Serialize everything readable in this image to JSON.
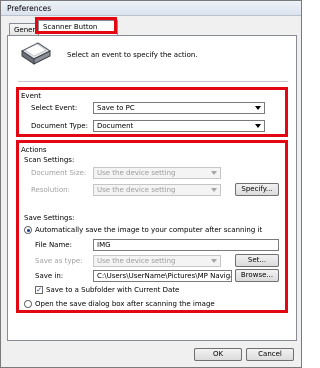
{
  "window": {
    "title": "Preferences"
  },
  "tabs": [
    {
      "label": "General"
    },
    {
      "label": "Scanner Button Settings"
    }
  ],
  "intro_text": "Select an event to specify the action.",
  "event": {
    "group_label": "Event",
    "select_event_label": "Select Event:",
    "select_event_value": "Save to PC",
    "document_type_label": "Document Type:",
    "document_type_value": "Document"
  },
  "actions": {
    "group_label": "Actions",
    "scan_settings_label": "Scan Settings:",
    "document_size_label": "Document Size:",
    "document_size_value": "Use the device setting",
    "resolution_label": "Resolution:",
    "resolution_value": "Use the device setting",
    "specify_button": "Specify...",
    "save_settings_label": "Save Settings:",
    "auto_save_radio": "Automatically save the image to your computer after scanning it",
    "file_name_label": "File Name:",
    "file_name_value": "IMG",
    "save_as_type_label": "Save as type:",
    "save_as_type_value": "Use the device setting",
    "set_button": "Set...",
    "save_in_label": "Save in:",
    "save_in_value": "C:\\Users\\UserName\\Pictures\\MP Navigato",
    "browse_button": "Browse...",
    "subfolder_checkbox": "Save to a Subfolder with Current Date",
    "open_dialog_radio": "Open the save dialog box after scanning the image"
  },
  "footer": {
    "ok_button": "OK",
    "cancel_button": "Cancel"
  },
  "colors": {
    "highlight_red": "#e30613",
    "window_bg": "#f0f0f0",
    "panel_bg": "#ffffff"
  }
}
